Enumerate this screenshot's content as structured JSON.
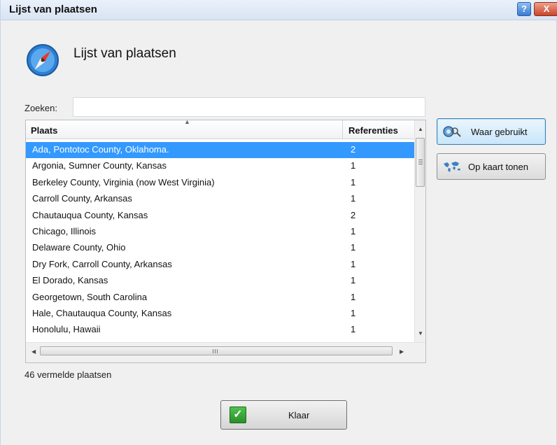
{
  "window": {
    "title": "Lijst van plaatsen"
  },
  "heading": "Lijst van plaatsen",
  "search": {
    "label": "Zoeken:",
    "value": "",
    "placeholder": ""
  },
  "table": {
    "columns": {
      "place": "Plaats",
      "refs": "Referenties"
    },
    "rows": [
      {
        "place": "Ada, Pontotoc County, Oklahoma.",
        "refs": "2"
      },
      {
        "place": "Argonia, Sumner County, Kansas",
        "refs": "1"
      },
      {
        "place": "Berkeley County, Virginia (now West Virginia)",
        "refs": "1"
      },
      {
        "place": "Carroll County, Arkansas",
        "refs": "1"
      },
      {
        "place": "Chautauqua County, Kansas",
        "refs": "2"
      },
      {
        "place": "Chicago, Illinois",
        "refs": "1"
      },
      {
        "place": "Delaware County, Ohio",
        "refs": "1"
      },
      {
        "place": "Dry Fork, Carroll County, Arkansas",
        "refs": "1"
      },
      {
        "place": "El Dorado, Kansas",
        "refs": "1"
      },
      {
        "place": "Georgetown, South Carolina",
        "refs": "1"
      },
      {
        "place": "Hale, Chautauqua County, Kansas",
        "refs": "1"
      },
      {
        "place": "Honolulu, Hawaii",
        "refs": "1"
      }
    ],
    "selected_index": 0
  },
  "buttons": {
    "where_used": "Waar gebruikt",
    "show_on_map": "Op kaart tonen",
    "done": "Klaar",
    "help": "?",
    "close": "X"
  },
  "status": "46 vermelde plaatsen",
  "colors": {
    "selection": "#3399ff",
    "titlebar": "#dfe9f5"
  },
  "icons": {
    "app": "compass-icon",
    "where_used": "magnifier-icon",
    "map": "world-map-icon",
    "done": "checkmark-icon"
  }
}
